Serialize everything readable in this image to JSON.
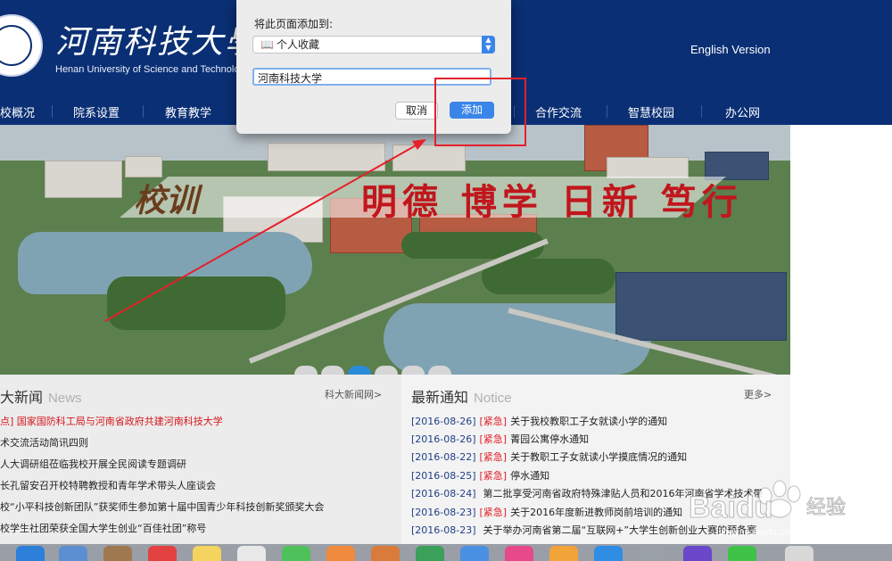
{
  "header": {
    "cn_title": "河南科技大學",
    "en_title": "Henan University of Science and Technology",
    "english_version": "English Version"
  },
  "nav": {
    "items": [
      "校概况",
      "院系设置",
      "教育教学",
      "合作交流",
      "智慧校园",
      "办公网"
    ]
  },
  "banner": {
    "motto_label": "校训",
    "motto_text": "明德 博学 日新 笃行",
    "slide_count": 6,
    "active_slide": 3
  },
  "news": {
    "title": "大新闻",
    "title_en": "News",
    "more": "科大新闻网>",
    "items": [
      {
        "text": "点] 国家国防科工局与河南省政府共建河南科技大学",
        "hot": true
      },
      {
        "text": "术交流活动简讯四则",
        "hot": false
      },
      {
        "text": "人大调研组莅临我校开展全民阅读专题调研",
        "hot": false
      },
      {
        "text": "长孔留安召开校特聘教授和青年学术带头人座谈会",
        "hot": false
      },
      {
        "text": "校“小平科技创新团队”获奖师生参加第十届中国青少年科技创新奖颁奖大会",
        "hot": false
      },
      {
        "text": "校学生社团荣获全国大学生创业“百佳社团”称号",
        "hot": false
      }
    ]
  },
  "notices": {
    "title": "最新通知",
    "title_en": "Notice",
    "more": "更多>",
    "items": [
      {
        "date": "[2016-08-26]",
        "tag": "[紧急]",
        "text": "关于我校教职工子女就读小学的通知"
      },
      {
        "date": "[2016-08-26]",
        "tag": "[紧急]",
        "text": "菁园公寓停水通知"
      },
      {
        "date": "[2016-08-22]",
        "tag": "[紧急]",
        "text": "关于教职工子女就读小学摸底情况的通知"
      },
      {
        "date": "[2016-08-25]",
        "tag": "[紧急]",
        "text": "停水通知"
      },
      {
        "date": "[2016-08-24]",
        "tag": "",
        "text": "第二批享受河南省政府特殊津贴人员和2016年河南省学术技术带"
      },
      {
        "date": "[2016-08-23]",
        "tag": "[紧急]",
        "text": "关于2016年度新进教师岗前培训的通知"
      },
      {
        "date": "[2016-08-23]",
        "tag": "",
        "text": "关于举办河南省第二届“互联网+”大学生创新创业大赛的预备赛"
      }
    ]
  },
  "dialog": {
    "title": "将此页面添加到:",
    "folder": "个人收藏",
    "folder_icon": "book-icon",
    "name_value": "河南科技大学",
    "cancel": "取消",
    "add": "添加"
  },
  "watermark": {
    "brand": "Baidu",
    "suffix": "经验",
    "url": "jingyan.baidu.com"
  },
  "colors": {
    "header_bg": "#0a2f74",
    "accent_blue": "#3a86e8",
    "annotation_red": "#e5202a",
    "urgent_red": "#e0202a",
    "date_blue": "#1f3f86"
  }
}
